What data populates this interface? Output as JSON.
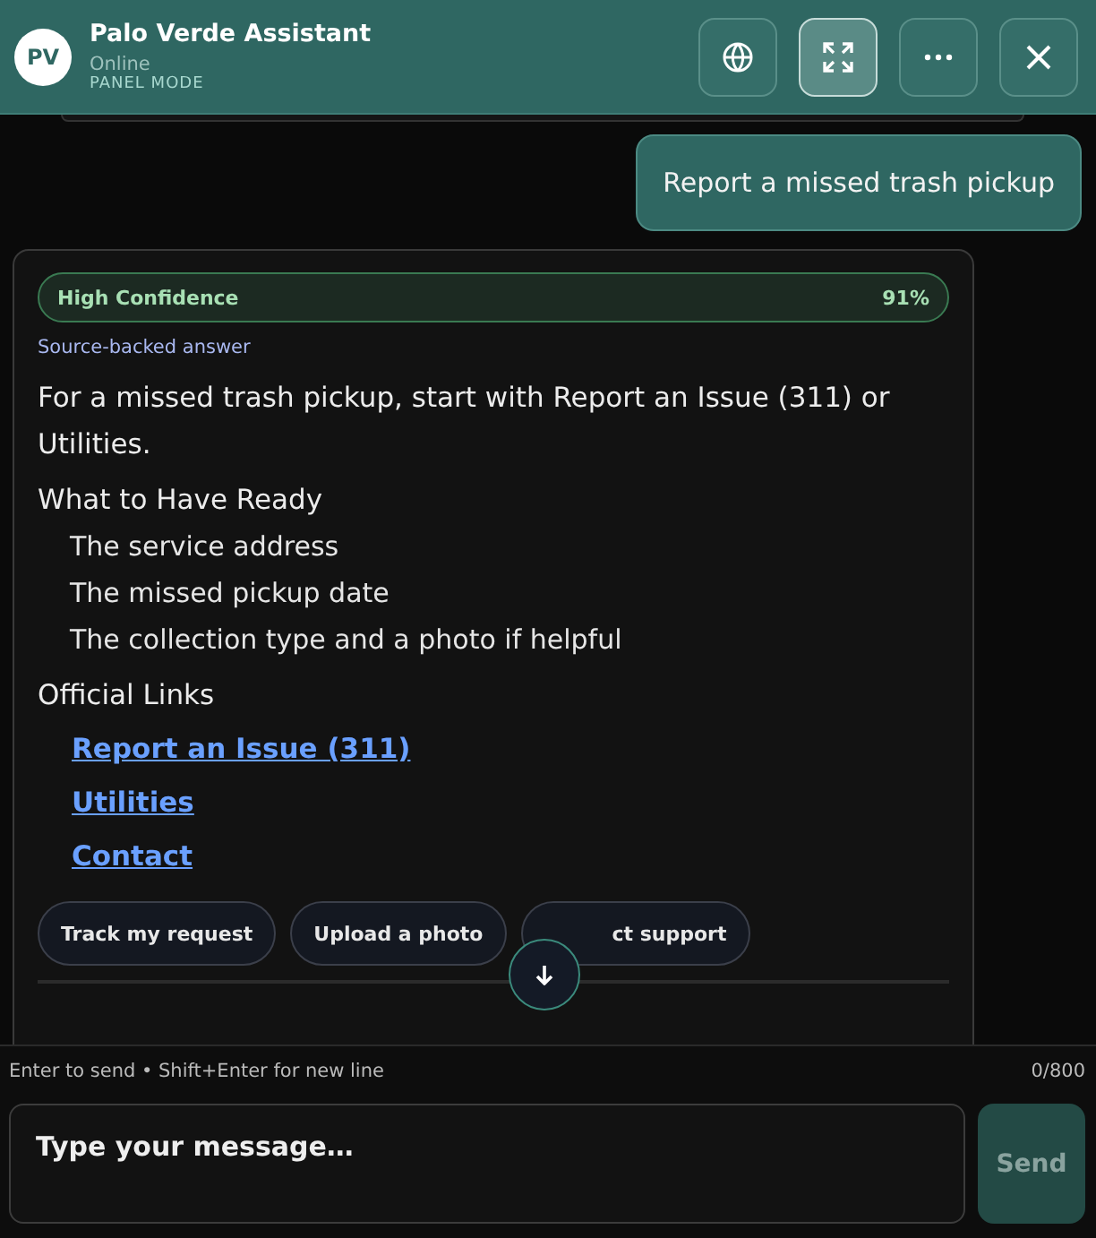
{
  "header": {
    "avatar": "PV",
    "title": "Palo Verde Assistant",
    "status": "Online",
    "mode": "PANEL MODE",
    "buttons": [
      {
        "kind": "globe",
        "selected": false
      },
      {
        "kind": "expand",
        "selected": true
      },
      {
        "kind": "more",
        "selected": false
      },
      {
        "kind": "close",
        "selected": false
      }
    ]
  },
  "user_message": "Report a missed trash pickup",
  "answer": {
    "confidence": {
      "label": "High Confidence",
      "value": "91%"
    },
    "source_note": "Source-backed answer",
    "intro": "For a missed trash pickup, start with Report an Issue (311) or Utilities.",
    "sections": [
      {
        "heading": "What to Have Ready",
        "kind": "list",
        "items": [
          "The service address",
          "The missed pickup date",
          "The collection type and a photo if helpful"
        ]
      },
      {
        "heading": "Official Links",
        "kind": "links",
        "items": [
          "Report an Issue (311)",
          "Utilities",
          "Contact"
        ]
      }
    ],
    "suggestions": [
      "Track my request",
      "Upload a photo",
      "ct support"
    ]
  },
  "composer": {
    "hint": "Enter to send • Shift+Enter for new line",
    "count": "0/800",
    "placeholder": "Type your message…",
    "send": "Send"
  }
}
